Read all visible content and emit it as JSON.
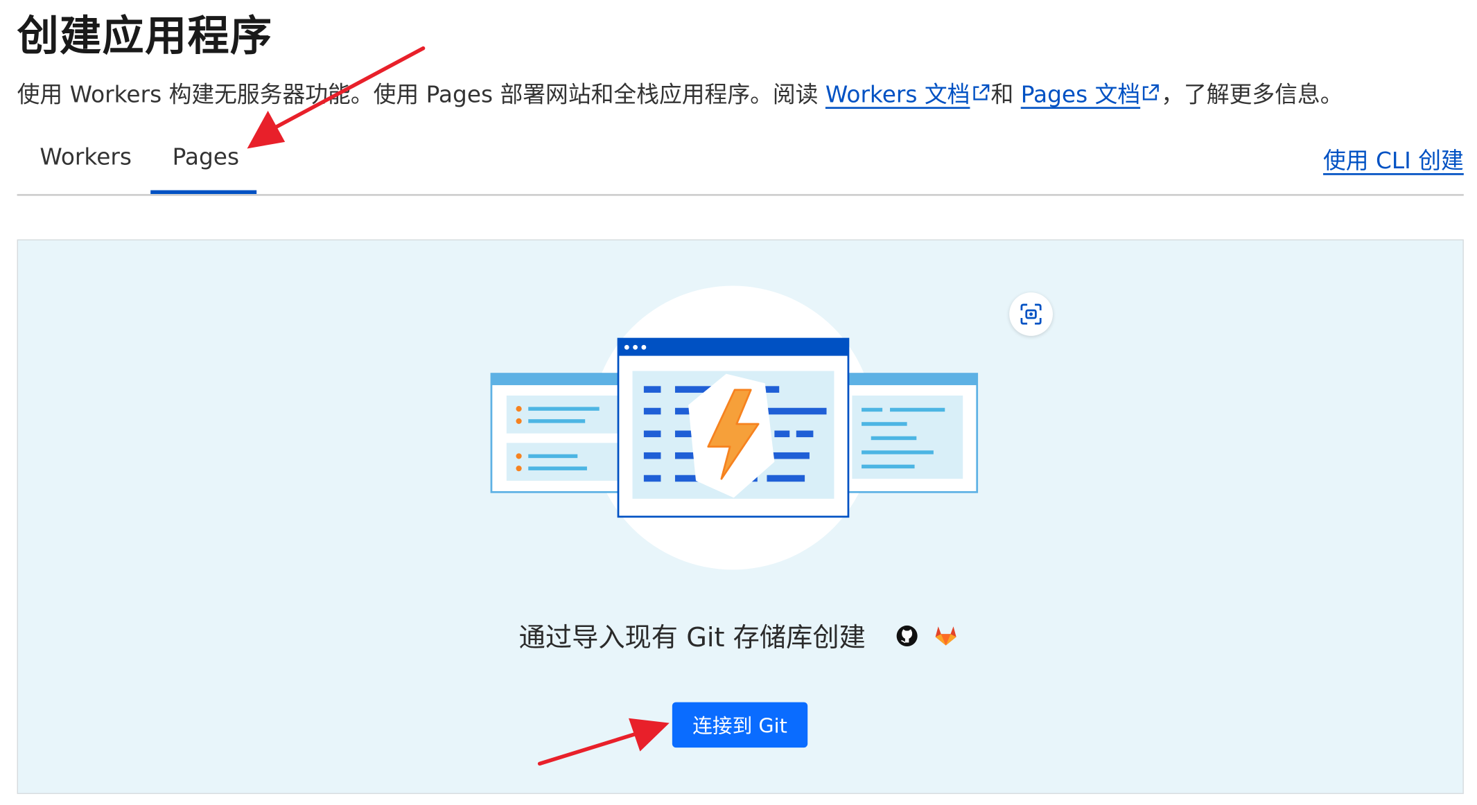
{
  "header": {
    "title": "创建应用程序",
    "subtitle_part1": "使用 Workers 构建无服务器功能。使用 Pages 部署网站和全栈应用程序。阅读 ",
    "workers_docs_link": "Workers 文档",
    "subtitle_part2": "和 ",
    "pages_docs_link": "Pages 文档",
    "subtitle_part3": "，了解更多信息。"
  },
  "tabs": [
    {
      "label": "Workers",
      "active": false
    },
    {
      "label": "Pages",
      "active": true
    }
  ],
  "cli_link": "使用 CLI 创建",
  "panel": {
    "heading": "通过导入现有 Git 存储库创建",
    "providers": [
      "github-icon",
      "gitlab-icon"
    ],
    "connect_button": "连接到 Git"
  },
  "colors": {
    "accent": "#0051c3",
    "button": "#0a6cff",
    "panel_bg": "#e8f5fa",
    "annotation_arrow": "#e8202a"
  }
}
